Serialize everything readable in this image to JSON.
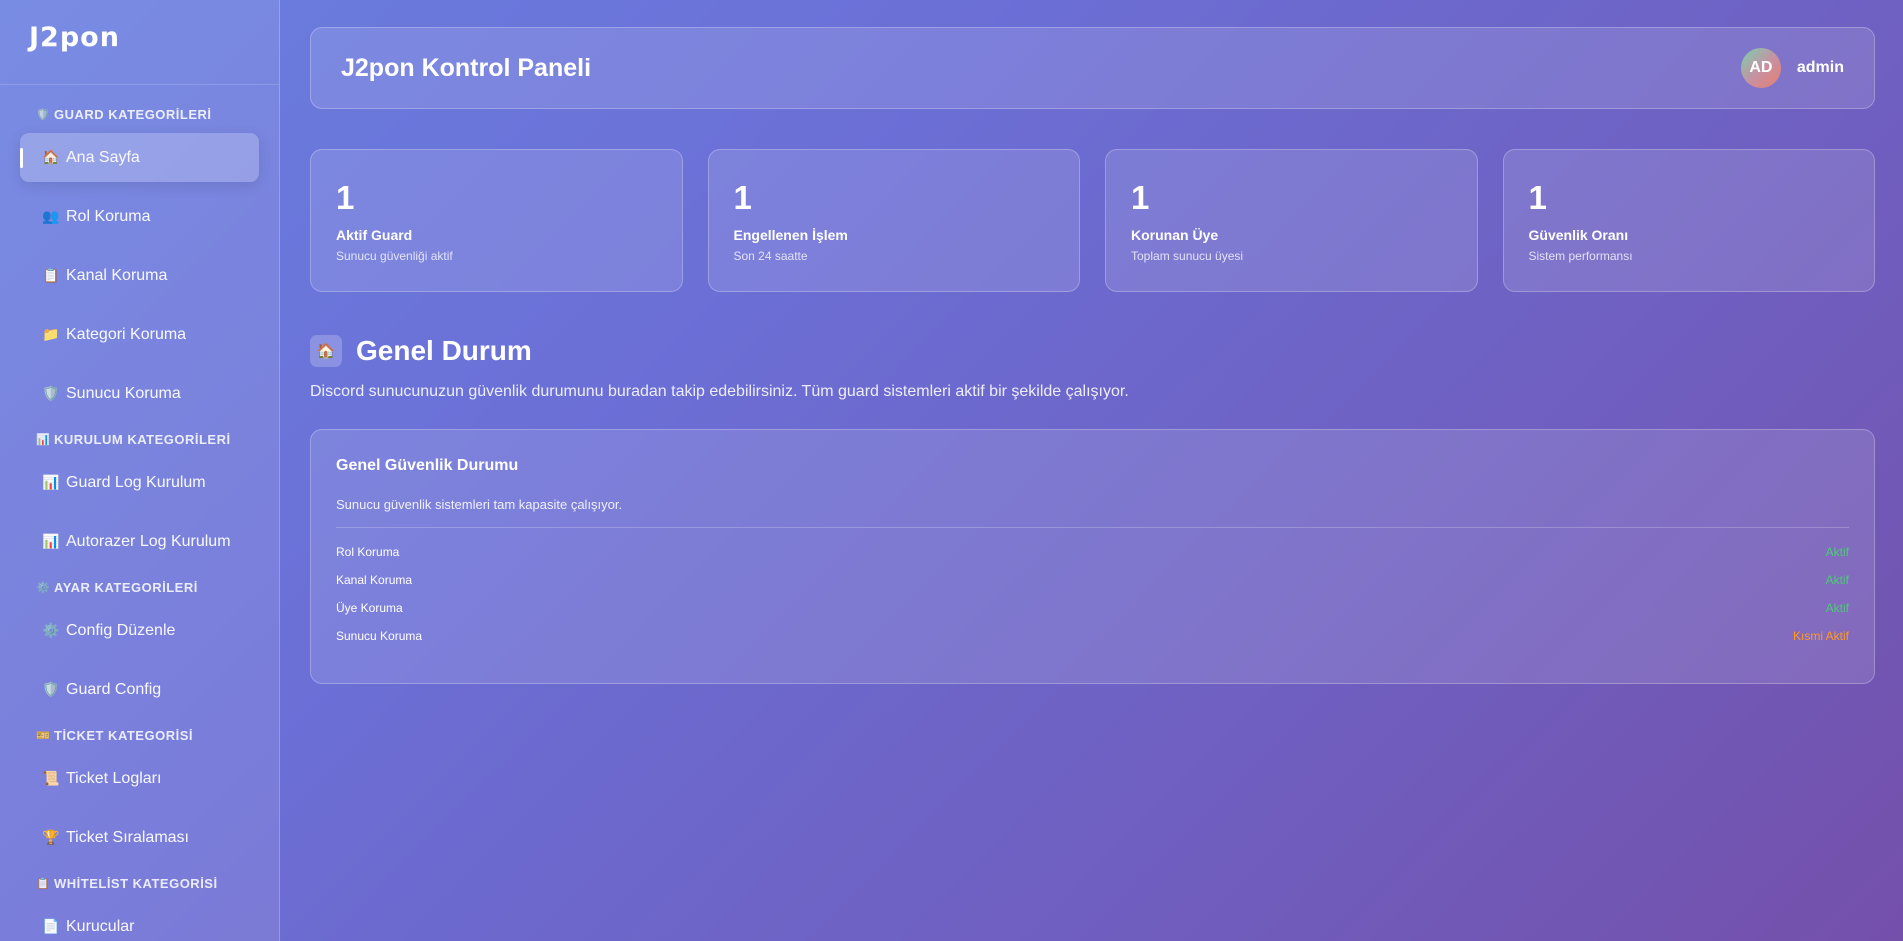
{
  "brand": "J2pon",
  "sidebar": {
    "sections": [
      {
        "icon": "🛡️",
        "icon_name": "shield-icon",
        "title": "GUARD KATEGORİLERİ",
        "items": [
          {
            "icon": "🏠",
            "icon_name": "home-icon",
            "label": "Ana Sayfa",
            "active": true
          },
          {
            "icon": "👥",
            "icon_name": "users-icon",
            "label": "Rol Koruma"
          },
          {
            "icon": "📋",
            "icon_name": "clipboard-icon",
            "label": "Kanal Koruma"
          },
          {
            "icon": "📁",
            "icon_name": "folder-icon",
            "label": "Kategori Koruma"
          },
          {
            "icon": "🛡️",
            "icon_name": "shield-icon",
            "label": "Sunucu Koruma"
          }
        ]
      },
      {
        "icon": "📊",
        "icon_name": "chart-icon",
        "title": "KURULUM KATEGORİLERİ",
        "items": [
          {
            "icon": "📊",
            "icon_name": "chart-icon",
            "label": "Guard Log Kurulum"
          },
          {
            "icon": "📊",
            "icon_name": "chart-icon",
            "label": "Autorazer Log Kurulum"
          }
        ]
      },
      {
        "icon": "⚙️",
        "icon_name": "gear-icon",
        "title": "AYAR KATEGORİLERİ",
        "items": [
          {
            "icon": "⚙️",
            "icon_name": "gear-icon",
            "label": "Config Düzenle"
          },
          {
            "icon": "🛡️",
            "icon_name": "shield-icon",
            "label": "Guard Config"
          }
        ]
      },
      {
        "icon": "🎫",
        "icon_name": "ticket-icon",
        "title": "TİCKET KATEGORİSİ",
        "items": [
          {
            "icon": "📜",
            "icon_name": "scroll-icon",
            "label": "Ticket Logları"
          },
          {
            "icon": "🏆",
            "icon_name": "trophy-icon",
            "label": "Ticket Sıralaması"
          }
        ]
      },
      {
        "icon": "📋",
        "icon_name": "clipboard-icon",
        "title": "WHİTELİST KATEGORİSİ",
        "items": [
          {
            "icon": "📄",
            "icon_name": "document-icon",
            "label": "Kurucular"
          }
        ]
      }
    ]
  },
  "header": {
    "title": "J2pon Kontrol Paneli",
    "avatar_initials": "AD",
    "username": "admin"
  },
  "stats": [
    {
      "value": "1",
      "label": "Aktif Guard",
      "sub": "Sunucu güvenliği aktif"
    },
    {
      "value": "1",
      "label": "Engellenen İşlem",
      "sub": "Son 24 saatte"
    },
    {
      "value": "1",
      "label": "Korunan Üye",
      "sub": "Toplam sunucu üyesi"
    },
    {
      "value": "1",
      "label": "Güvenlik Oranı",
      "sub": "Sistem performansı"
    }
  ],
  "overview": {
    "icon": "🏠",
    "title": "Genel Durum",
    "description": "Discord sunucunuzun güvenlik durumunu buradan takip edebilirsiniz. Tüm guard sistemleri aktif bir şekilde çalışıyor."
  },
  "status_card": {
    "title": "Genel Güvenlik Durumu",
    "description": "Sunucu güvenlik sistemleri tam kapasite çalışıyor.",
    "rows": [
      {
        "name": "Rol Koruma",
        "status": "Aktif",
        "state": "ok"
      },
      {
        "name": "Kanal Koruma",
        "status": "Aktif",
        "state": "ok"
      },
      {
        "name": "Üye Koruma",
        "status": "Aktif",
        "state": "ok"
      },
      {
        "name": "Sunucu Koruma",
        "status": "Kısmi Aktif",
        "state": "partial"
      }
    ]
  },
  "colors": {
    "status_ok": "#4ec97a",
    "status_partial": "#ff9a1f",
    "bg_start": "#6a7fe0",
    "bg_end": "#7450ab"
  }
}
